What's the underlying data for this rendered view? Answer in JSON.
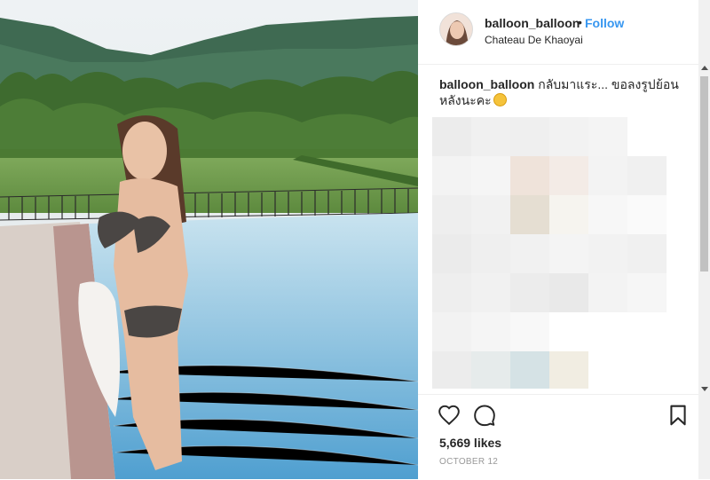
{
  "post": {
    "username": "balloon_balloon",
    "separator": "•",
    "follow_label": "Follow",
    "location": "Chateau De Khaoyai",
    "caption_user": "balloon_balloon",
    "caption_text": "กลับมาแระ... ขอลงรูปย้อนหลังนะคะ",
    "caption_emoji": "smiling-face-emoji",
    "likes": "5,669 likes",
    "date": "OCTOBER 12"
  },
  "icons": {
    "like": "heart-icon",
    "comment": "comment-icon",
    "save": "bookmark-icon"
  },
  "colors": {
    "follow_blue": "#3897f0",
    "text": "#262626",
    "muted": "#999999"
  }
}
